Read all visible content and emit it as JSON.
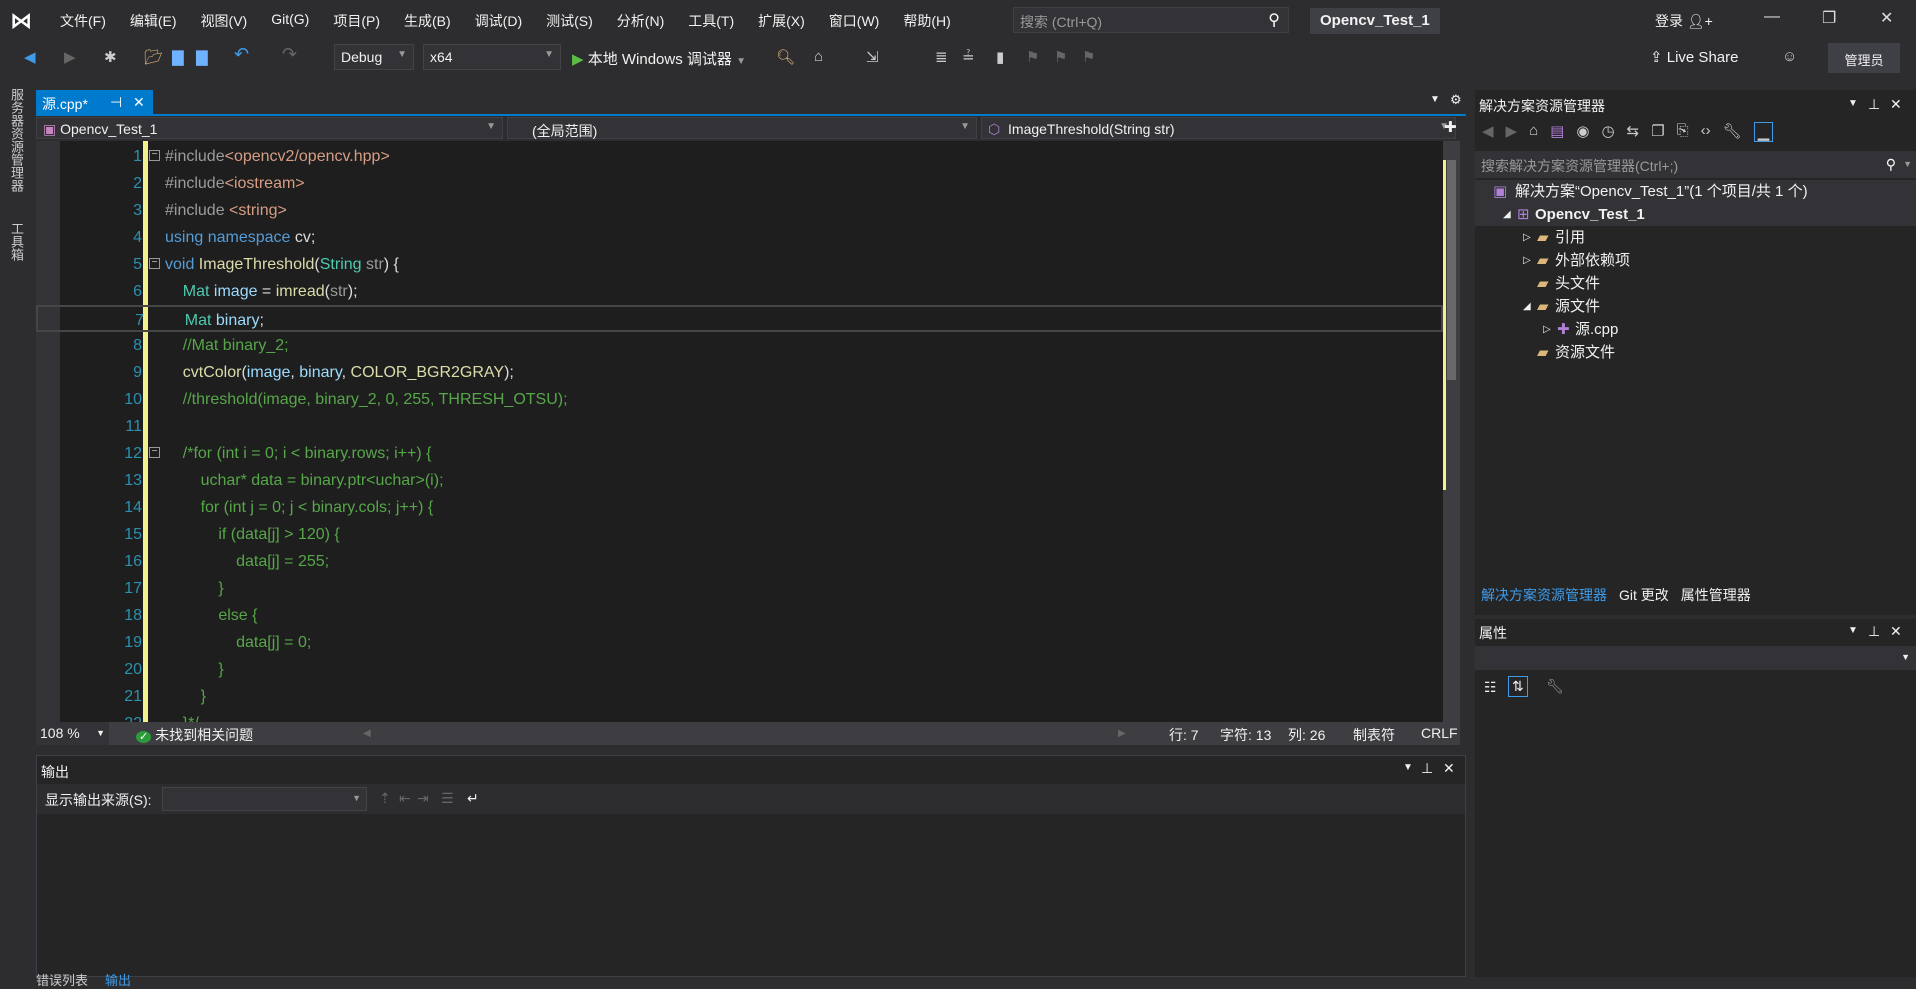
{
  "menubar": {
    "items": [
      "文件(F)",
      "编辑(E)",
      "视图(V)",
      "Git(G)",
      "项目(P)",
      "生成(B)",
      "调试(D)",
      "测试(S)",
      "分析(N)",
      "工具(T)",
      "扩展(X)",
      "窗口(W)",
      "帮助(H)"
    ],
    "search_placeholder": "搜索 (Ctrl+Q)",
    "solution_title": "Opencv_Test_1",
    "login": "登录"
  },
  "toolbar": {
    "config": "Debug",
    "platform": "x64",
    "run_label": "本地 Windows 调试器",
    "live_share": "Live Share",
    "admin": "管理员"
  },
  "left_strip": {
    "tabs": [
      "服务器资源管理器",
      "工具箱"
    ]
  },
  "editor": {
    "tab_label": "源.cpp*",
    "nav_project": "Opencv_Test_1",
    "nav_scope": "(全局范围)",
    "nav_member": "ImageThreshold(String str)",
    "current_line": 7,
    "lines": [
      [
        [
          "c-pp",
          "#include"
        ],
        [
          "c-inc",
          "<opencv2/opencv.hpp>"
        ]
      ],
      [
        [
          "c-pp",
          "#include"
        ],
        [
          "c-inc",
          "<iostream>"
        ]
      ],
      [
        [
          "c-pp",
          "#include "
        ],
        [
          "c-inc",
          "<string>"
        ]
      ],
      [
        [
          "c-kw",
          "using namespace "
        ],
        [
          "c-pl",
          "cv;"
        ]
      ],
      [
        [
          "c-kw",
          "void "
        ],
        [
          "c-fn",
          "ImageThreshold"
        ],
        [
          "c-pl",
          "("
        ],
        [
          "c-ty",
          "String "
        ],
        [
          "c-par",
          "str"
        ],
        [
          "c-pl",
          ") {"
        ]
      ],
      [
        [
          "c-pl",
          "    "
        ],
        [
          "c-ty",
          "Mat "
        ],
        [
          "c-var",
          "image"
        ],
        [
          "c-pl",
          " = "
        ],
        [
          "c-fn",
          "imread"
        ],
        [
          "c-pl",
          "("
        ],
        [
          "c-par",
          "str"
        ],
        [
          "c-pl",
          ");"
        ]
      ],
      [
        [
          "c-pl",
          "    "
        ],
        [
          "c-ty",
          "Mat "
        ],
        [
          "c-var",
          "binary"
        ],
        [
          "c-pl",
          ";"
        ]
      ],
      [
        [
          "c-cm",
          "    //Mat binary_2;"
        ]
      ],
      [
        [
          "c-pl",
          "    "
        ],
        [
          "c-fn",
          "cvtColor"
        ],
        [
          "c-pl",
          "("
        ],
        [
          "c-var",
          "image"
        ],
        [
          "c-pl",
          ", "
        ],
        [
          "c-var",
          "binary"
        ],
        [
          "c-pl",
          ", "
        ],
        [
          "c-fn",
          "COLOR_BGR2GRAY"
        ],
        [
          "c-pl",
          ");"
        ]
      ],
      [
        [
          "c-cm",
          "    //threshold(image, binary_2, 0, 255, THRESH_OTSU);"
        ]
      ],
      [],
      [
        [
          "c-cm",
          "    /*for (int i = 0; i < binary.rows; i++) {"
        ]
      ],
      [
        [
          "c-cm",
          "        uchar* data = binary.ptr<uchar>(i);"
        ]
      ],
      [
        [
          "c-cm",
          "        for (int j = 0; j < binary.cols; j++) {"
        ]
      ],
      [
        [
          "c-cm",
          "            if (data[j] > 120) {"
        ]
      ],
      [
        [
          "c-cm",
          "                data[j] = 255;"
        ]
      ],
      [
        [
          "c-cm",
          "            }"
        ]
      ],
      [
        [
          "c-cm",
          "            else {"
        ]
      ],
      [
        [
          "c-cm",
          "                data[j] = 0;"
        ]
      ],
      [
        [
          "c-cm",
          "            }"
        ]
      ],
      [
        [
          "c-cm",
          "        }"
        ]
      ],
      [
        [
          "c-cm",
          "    }*/"
        ]
      ]
    ]
  },
  "status": {
    "zoom": "108 %",
    "issues": "未找到相关问题",
    "line": "行: 7",
    "char": "字符: 13",
    "col": "列: 26",
    "indent": "制表符",
    "eol": "CRLF"
  },
  "output": {
    "title": "输出",
    "source_label": "显示输出来源(S):",
    "source_value": "",
    "bottom_tabs": [
      "错误列表",
      "输出"
    ]
  },
  "solution_explorer": {
    "title": "解决方案资源管理器",
    "search_placeholder": "搜索解决方案资源管理器(Ctrl+;)",
    "tree": [
      {
        "label": "解决方案“Opencv_Test_1”(1 个项目/共 1 个)",
        "level": 0,
        "expander": ""
      },
      {
        "label": "Opencv_Test_1",
        "level": 1,
        "expander": "◢",
        "bold": true
      },
      {
        "label": "引用",
        "level": 2,
        "expander": "▷"
      },
      {
        "label": "外部依赖项",
        "level": 2,
        "expander": "▷"
      },
      {
        "label": "头文件",
        "level": 2,
        "expander": ""
      },
      {
        "label": "源文件",
        "level": 2,
        "expander": "◢"
      },
      {
        "label": "源.cpp",
        "level": 3,
        "expander": "▷"
      },
      {
        "label": "资源文件",
        "level": 2,
        "expander": ""
      }
    ],
    "tabs": [
      "解决方案资源管理器",
      "Git 更改",
      "属性管理器"
    ]
  },
  "properties": {
    "title": "属性"
  },
  "colors": {
    "accent": "#007acc",
    "changebar": "#f2f28a"
  }
}
